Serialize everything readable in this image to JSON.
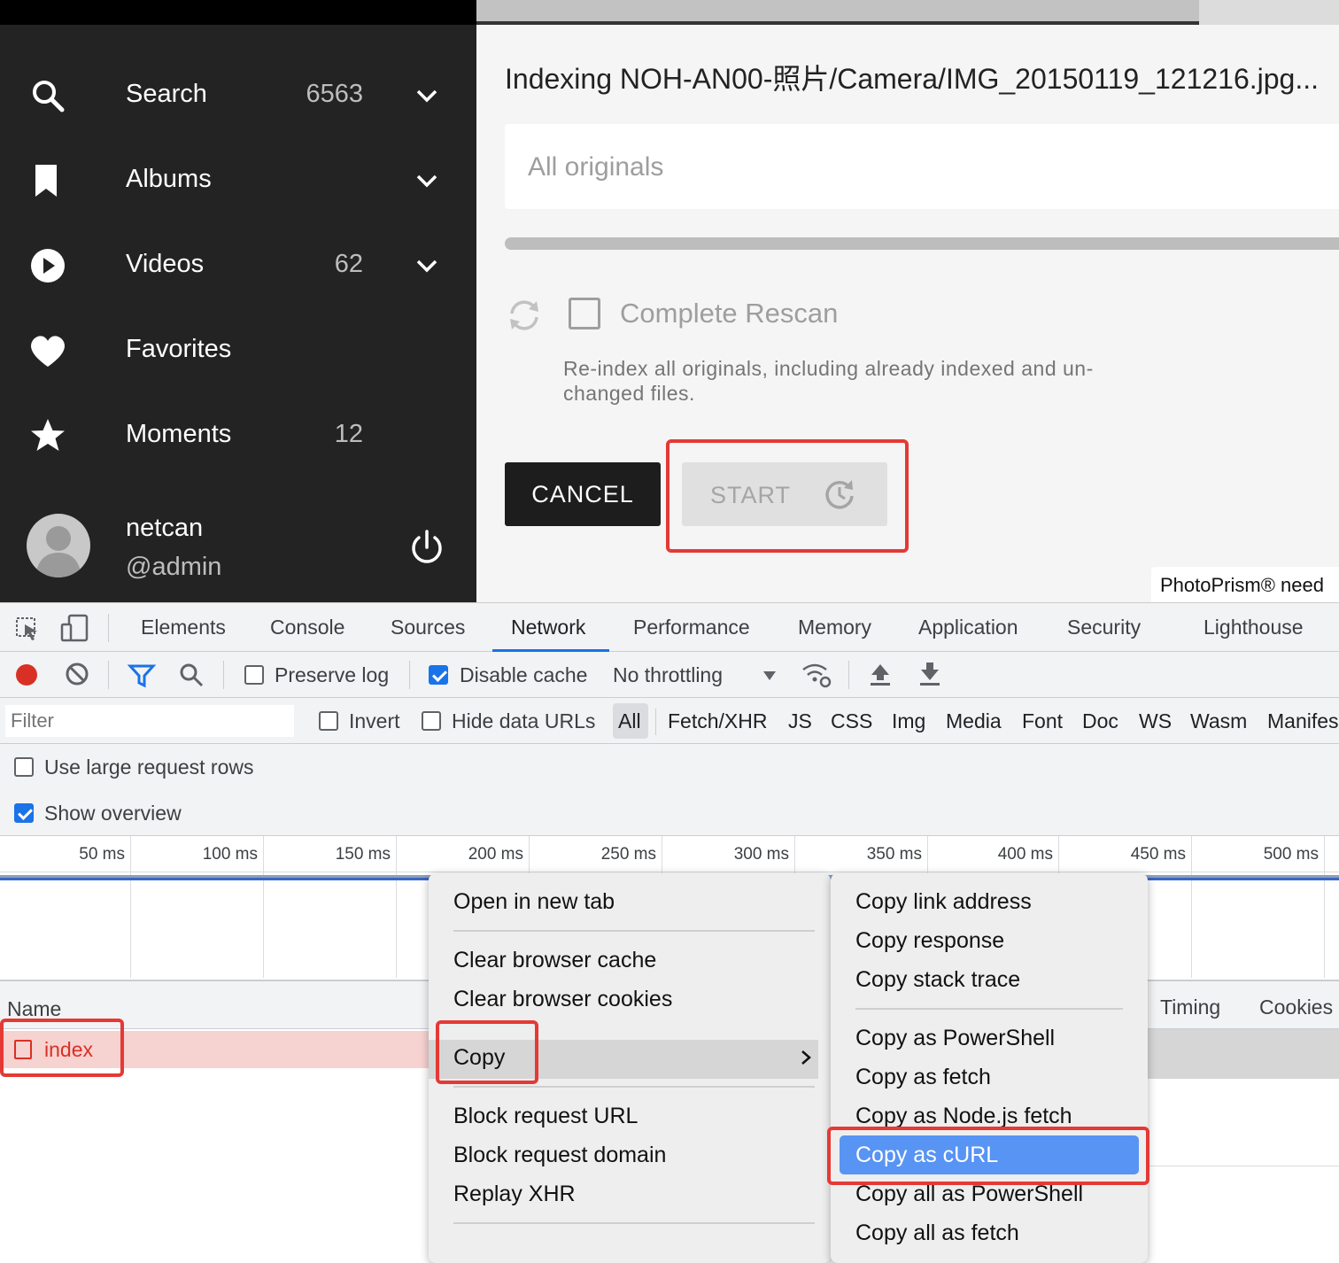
{
  "sidebar": {
    "items": [
      {
        "label": "Search",
        "count": "6563",
        "icon": "search-icon",
        "chevron": true
      },
      {
        "label": "Albums",
        "count": "",
        "icon": "bookmark-icon",
        "chevron": true
      },
      {
        "label": "Videos",
        "count": "62",
        "icon": "play-icon",
        "chevron": true
      },
      {
        "label": "Favorites",
        "count": "",
        "icon": "heart-icon",
        "chevron": false
      },
      {
        "label": "Moments",
        "count": "12",
        "icon": "star-icon",
        "chevron": false
      }
    ],
    "user": {
      "name": "netcan",
      "handle": "@admin"
    }
  },
  "main": {
    "status": "Indexing NOH-AN00-照片/Camera/IMG_20150119_121216.jpg...",
    "path_placeholder": "All originals",
    "rescan_label": "Complete Rescan",
    "rescan_hint": "Re-index all originals, including already indexed and un-changed files.",
    "cancel_label": "CANCEL",
    "start_label": "START",
    "notice": "PhotoPrism® need"
  },
  "devtools": {
    "tabs": [
      "Elements",
      "Console",
      "Sources",
      "Network",
      "Performance",
      "Memory",
      "Application",
      "Security",
      "Lighthouse"
    ],
    "active_tab": "Network",
    "toolbar": {
      "preserve_log": "Preserve log",
      "disable_cache": "Disable cache",
      "throttling": "No throttling"
    },
    "filter": {
      "placeholder": "Filter",
      "invert": "Invert",
      "hide_data_urls": "Hide data URLs",
      "types": [
        "All",
        "Fetch/XHR",
        "JS",
        "CSS",
        "Img",
        "Media",
        "Font",
        "Doc",
        "WS",
        "Wasm",
        "Manifes"
      ]
    },
    "options": {
      "large_rows": "Use large request rows",
      "show_overview": "Show overview"
    },
    "timeline_ticks": [
      "50 ms",
      "100 ms",
      "150 ms",
      "200 ms",
      "250 ms",
      "300 ms",
      "350 ms",
      "400 ms",
      "450 ms",
      "500 ms"
    ],
    "table": {
      "columns": [
        "Name",
        "Timing",
        "Cookies"
      ],
      "rows": [
        {
          "name": "index"
        }
      ]
    }
  },
  "context_menu": {
    "items": [
      "Open in new tab",
      "Clear browser cache",
      "Clear browser cookies",
      "Copy",
      "Block request URL",
      "Block request domain",
      "Replay XHR"
    ],
    "submenu": [
      "Copy link address",
      "Copy response",
      "Copy stack trace",
      "Copy as PowerShell",
      "Copy as fetch",
      "Copy as Node.js fetch",
      "Copy as cURL",
      "Copy all as PowerShell",
      "Copy all as fetch"
    ],
    "highlighted": "Copy as cURL"
  },
  "colors": {
    "sidebar_bg": "#232323",
    "highlight_red": "#e53935",
    "devtools_blue": "#1a73e8",
    "menu_selection": "#5894f3"
  }
}
